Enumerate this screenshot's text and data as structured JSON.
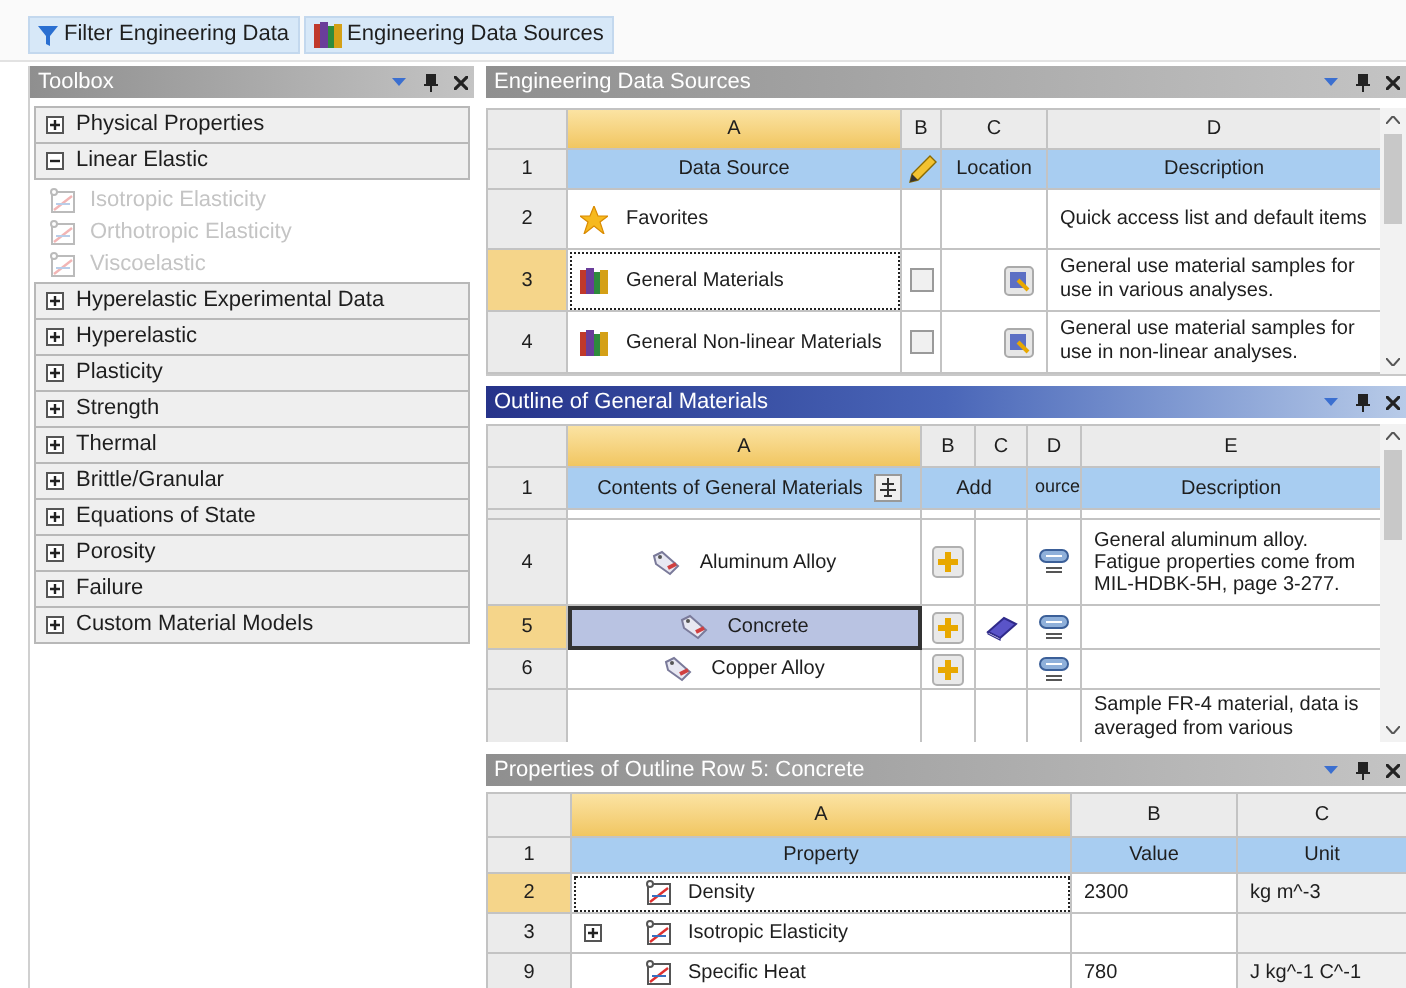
{
  "toolbar": {
    "buttons": [
      {
        "label": "Filter Engineering Data"
      },
      {
        "label": "Engineering Data Sources"
      }
    ]
  },
  "toolbox": {
    "title": "Toolbox",
    "groups": [
      {
        "label": "Physical Properties",
        "expanded": false
      },
      {
        "label": "Linear Elastic",
        "expanded": true,
        "children": [
          {
            "label": "Isotropic Elasticity",
            "disabled": true
          },
          {
            "label": "Orthotropic Elasticity",
            "disabled": true
          },
          {
            "label": "Viscoelastic",
            "disabled": true
          }
        ]
      },
      {
        "label": "Hyperelastic Experimental Data",
        "expanded": false
      },
      {
        "label": "Hyperelastic",
        "expanded": false
      },
      {
        "label": "Plasticity",
        "expanded": false
      },
      {
        "label": "Strength",
        "expanded": false
      },
      {
        "label": "Thermal",
        "expanded": false
      },
      {
        "label": "Brittle/Granular",
        "expanded": false
      },
      {
        "label": "Equations of State",
        "expanded": false
      },
      {
        "label": "Porosity",
        "expanded": false
      },
      {
        "label": "Failure",
        "expanded": false
      },
      {
        "label": "Custom Material Models",
        "expanded": false
      }
    ]
  },
  "sources": {
    "title": "Engineering Data Sources",
    "active": false,
    "columns": [
      {
        "letter": "A",
        "selected": true
      },
      {
        "letter": "B",
        "selected": false
      },
      {
        "letter": "C",
        "selected": false
      },
      {
        "letter": "D",
        "selected": false
      }
    ],
    "header": {
      "row": "1",
      "data_source": "Data Source",
      "location": "Location",
      "description": "Description"
    },
    "rows": [
      {
        "row": "2",
        "kind": "favorites",
        "name": "Favorites",
        "description": "Quick access list and default items",
        "selected": false
      },
      {
        "row": "3",
        "kind": "library",
        "name": "General Materials",
        "checked": false,
        "description": "General use material samples for use in various analyses.",
        "selected": true
      },
      {
        "row": "4",
        "kind": "library",
        "name": "General Non-linear Materials",
        "checked": false,
        "description": "General use material samples for use in non-linear analyses.",
        "selected": false
      }
    ]
  },
  "outline": {
    "title": "Outline of General Materials",
    "active": true,
    "columns": [
      {
        "letter": "A",
        "selected": true
      },
      {
        "letter": "B",
        "selected": false
      },
      {
        "letter": "C",
        "selected": false
      },
      {
        "letter": "D",
        "selected": false
      },
      {
        "letter": "E",
        "selected": false
      }
    ],
    "header": {
      "row": "1",
      "contents": "Contents of General Materials",
      "add": "Add",
      "source": "ource",
      "description": "Description"
    },
    "rows": [
      {
        "row": "4",
        "name": "Aluminum Alloy",
        "in_library": false,
        "description": "General aluminum alloy. Fatigue properties come from MIL-HDBK-5H, page 3-277.",
        "selected": false
      },
      {
        "row": "5",
        "name": "Concrete",
        "in_library": true,
        "selected": true
      },
      {
        "row": "6",
        "name": "Copper Alloy",
        "in_library": false,
        "selected": false
      }
    ],
    "partial_row": {
      "description": "Sample FR-4 material, data is averaged from various"
    }
  },
  "properties": {
    "title": "Properties of Outline Row 5: Concrete",
    "active": false,
    "columns": [
      {
        "letter": "A",
        "selected": true
      },
      {
        "letter": "B",
        "selected": false
      },
      {
        "letter": "C",
        "selected": false
      }
    ],
    "header": {
      "row": "1",
      "property": "Property",
      "value": "Value",
      "unit": "Unit"
    },
    "rows": [
      {
        "row": "2",
        "kind": "property",
        "name": "Density",
        "value": "2300",
        "unit": "kg m^-3",
        "selected": true
      },
      {
        "row": "3",
        "kind": "group",
        "expanded": false,
        "name": "Isotropic Elasticity",
        "selected": false
      },
      {
        "row": "9",
        "kind": "property",
        "name": "Specific Heat",
        "value": "780",
        "unit": "J kg^-1 C^-1",
        "selected": false
      }
    ]
  }
}
